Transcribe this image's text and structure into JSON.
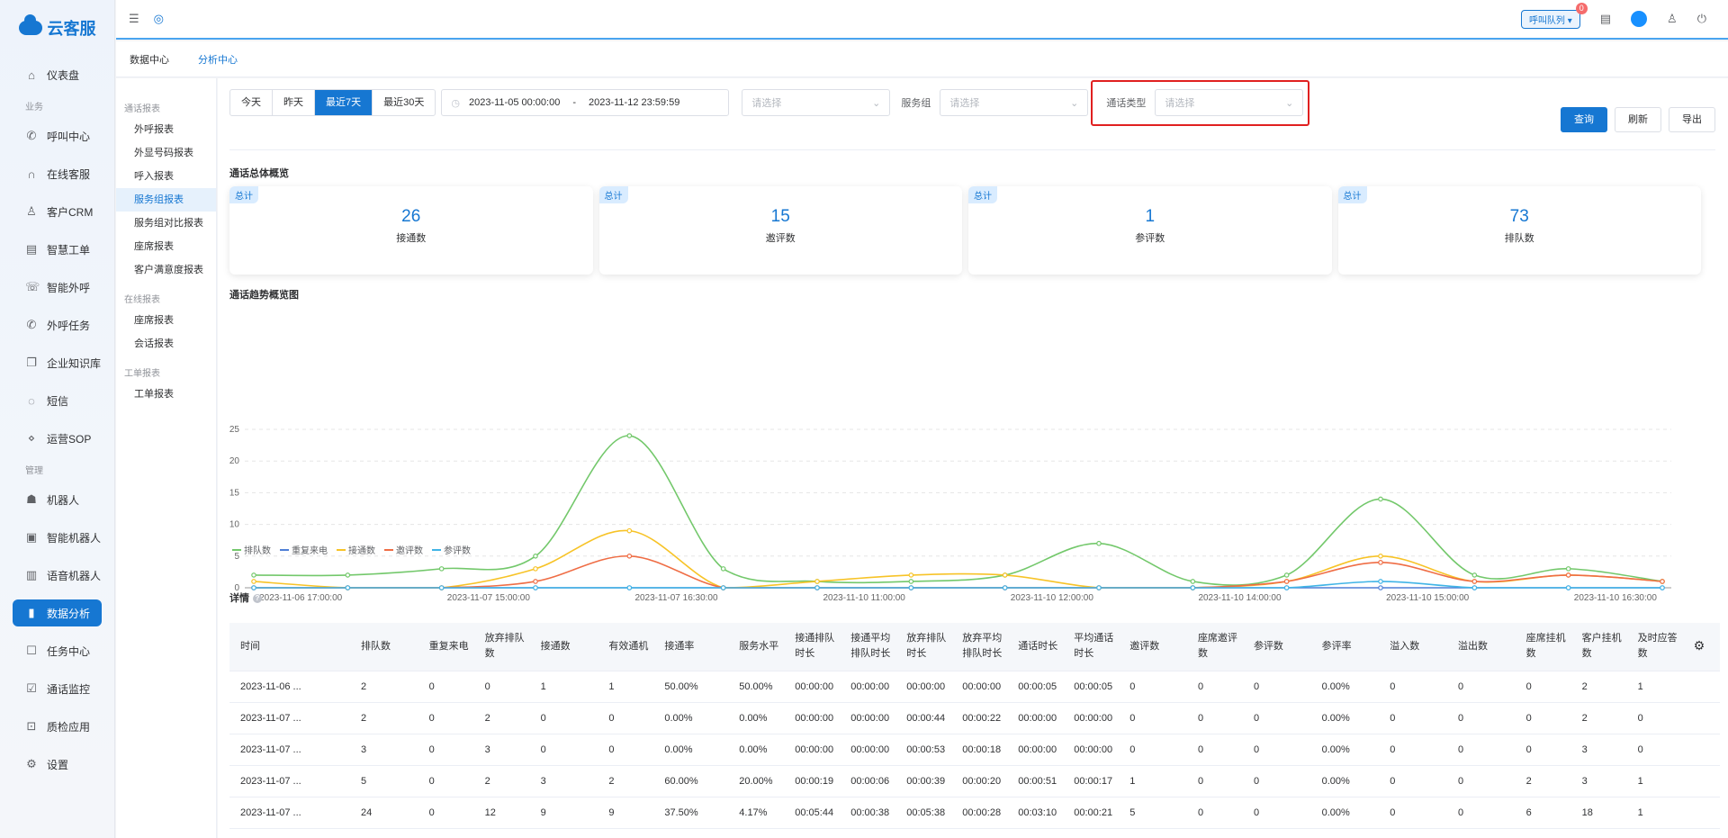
{
  "app": {
    "logo_text": "云客服"
  },
  "nav": {
    "items": [
      {
        "type": "item",
        "label": "仪表盘",
        "icon": "dashboard-icon",
        "glyph": "⌂"
      },
      {
        "type": "group",
        "label": "业务"
      },
      {
        "type": "item",
        "label": "呼叫中心",
        "icon": "phone-icon",
        "glyph": "✆"
      },
      {
        "type": "item",
        "label": "在线客服",
        "icon": "headset-icon",
        "glyph": "∩"
      },
      {
        "type": "item",
        "label": "客户CRM",
        "icon": "user-icon",
        "glyph": "♙"
      },
      {
        "type": "item",
        "label": "智慧工单",
        "icon": "document-icon",
        "glyph": "▤"
      },
      {
        "type": "item",
        "label": "智能外呼",
        "icon": "outbound-call-icon",
        "glyph": "☏"
      },
      {
        "type": "item",
        "label": "外呼任务",
        "icon": "task-call-icon",
        "glyph": "✆"
      },
      {
        "type": "item",
        "label": "企业知识库",
        "icon": "book-icon",
        "glyph": "❐"
      },
      {
        "type": "item",
        "label": "短信",
        "icon": "message-icon",
        "glyph": "◌"
      },
      {
        "type": "item",
        "label": "运营SOP",
        "icon": "flow-icon",
        "glyph": "⋄"
      },
      {
        "type": "group",
        "label": "管理"
      },
      {
        "type": "item",
        "label": "机器人",
        "icon": "robot-icon",
        "glyph": "☗"
      },
      {
        "type": "item",
        "label": "智能机器人",
        "icon": "smart-robot-icon",
        "glyph": "▣"
      },
      {
        "type": "item",
        "label": "语音机器人",
        "icon": "voice-robot-icon",
        "glyph": "▥"
      },
      {
        "type": "item",
        "label": "数据分析",
        "icon": "chart-icon",
        "glyph": "▮",
        "active": true
      },
      {
        "type": "item",
        "label": "任务中心",
        "icon": "task-icon",
        "glyph": "☐"
      },
      {
        "type": "item",
        "label": "通话监控",
        "icon": "monitor-icon",
        "glyph": "☑"
      },
      {
        "type": "item",
        "label": "质检应用",
        "icon": "inspect-icon",
        "glyph": "⊡"
      },
      {
        "type": "item",
        "label": "设置",
        "icon": "settings-icon",
        "glyph": "⚙"
      }
    ]
  },
  "topbar": {
    "queue_label": "呼叫队列",
    "queue_badge": "0"
  },
  "tabs": {
    "first": "数据中心",
    "second": "分析中心"
  },
  "submenu": [
    {
      "type": "group",
      "label": "通话报表"
    },
    {
      "type": "item",
      "label": "外呼报表"
    },
    {
      "type": "item",
      "label": "外显号码报表"
    },
    {
      "type": "item",
      "label": "呼入报表"
    },
    {
      "type": "item",
      "label": "服务组报表",
      "active": true
    },
    {
      "type": "item",
      "label": "服务组对比报表"
    },
    {
      "type": "item",
      "label": "座席报表"
    },
    {
      "type": "item",
      "label": "客户满意度报表"
    },
    {
      "type": "group",
      "label": "在线报表"
    },
    {
      "type": "item",
      "label": "座席报表"
    },
    {
      "type": "item",
      "label": "会话报表"
    },
    {
      "type": "group",
      "label": "工单报表"
    },
    {
      "type": "item",
      "label": "工单报表"
    }
  ],
  "filters": {
    "ranges": [
      "今天",
      "昨天",
      "最近7天",
      "最近30天"
    ],
    "active_range": "最近7天",
    "date_start": "2023-11-05 00:00:00",
    "date_sep": "-",
    "date_end": "2023-11-12 23:59:59",
    "select1_placeholder": "请选择",
    "group_label": "服务组",
    "group_placeholder": "请选择",
    "calltype_label": "通话类型",
    "calltype_placeholder": "请选择"
  },
  "actions": {
    "query": "查询",
    "refresh": "刷新",
    "export": "导出"
  },
  "overview": {
    "title": "通话总体概览",
    "cards": [
      {
        "tag": "总计",
        "value": "26",
        "caption": "接通数"
      },
      {
        "tag": "总计",
        "value": "15",
        "caption": "邀评数"
      },
      {
        "tag": "总计",
        "value": "1",
        "caption": "参评数"
      },
      {
        "tag": "总计",
        "value": "73",
        "caption": "排队数"
      }
    ]
  },
  "trend_title": "通话趋势概览图",
  "chart_data": {
    "type": "line",
    "ylim": [
      0,
      25
    ],
    "yticks": [
      0,
      5,
      10,
      15,
      20,
      25
    ],
    "x_tick_labels": [
      "2023-11-06 17:00:00",
      "2023-11-07 15:00:00",
      "2023-11-07 16:30:00",
      "2023-11-10 11:00:00",
      "2023-11-10 12:00:00",
      "2023-11-10 14:00:00",
      "2023-11-10 15:00:00",
      "2023-11-10 16:30:00"
    ],
    "point_count": 16,
    "grid": true,
    "legend_position": "bottom-left",
    "series": [
      {
        "name": "排队数",
        "color": "#73c86b",
        "values": [
          2,
          2,
          3,
          5,
          24,
          3,
          1,
          1,
          2,
          7,
          1,
          2,
          14,
          2,
          3,
          1
        ]
      },
      {
        "name": "重复来电",
        "color": "#4f7fd6",
        "values": [
          0,
          0,
          0,
          0,
          0,
          0,
          0,
          0,
          0,
          0,
          0,
          0,
          0,
          0,
          0,
          0
        ]
      },
      {
        "name": "接通数",
        "color": "#f7c327",
        "values": [
          1,
          0,
          0,
          3,
          9,
          0,
          1,
          2,
          2,
          0,
          0,
          1,
          5,
          1,
          2,
          1
        ]
      },
      {
        "name": "邀评数",
        "color": "#ef6d45",
        "values": [
          0,
          0,
          0,
          1,
          5,
          0,
          0,
          0,
          0,
          0,
          0,
          1,
          4,
          1,
          2,
          1
        ]
      },
      {
        "name": "参评数",
        "color": "#40b4e6",
        "values": [
          0,
          0,
          0,
          0,
          0,
          0,
          0,
          0,
          0,
          0,
          0,
          0,
          1,
          0,
          0,
          0
        ]
      }
    ]
  },
  "detail": {
    "title": "详情",
    "info": "?",
    "columns": [
      "时间",
      "排队数",
      "重复来电",
      "放弃排队数",
      "接通数",
      "有效通机",
      "接通率",
      "服务水平",
      "接通排队时长",
      "接通平均排队时长",
      "放弃排队时长",
      "放弃平均排队时长",
      "通话时长",
      "平均通话时长",
      "邀评数",
      "座席邀评数",
      "参评数",
      "参评率",
      "溢入数",
      "溢出数",
      "座席挂机数",
      "客户挂机数",
      "及时应答数"
    ],
    "rows": [
      [
        "2023-11-06 ...",
        "2",
        "0",
        "0",
        "1",
        "1",
        "50.00%",
        "50.00%",
        "00:00:00",
        "00:00:00",
        "00:00:00",
        "00:00:00",
        "00:00:05",
        "00:00:05",
        "0",
        "0",
        "0",
        "0.00%",
        "0",
        "0",
        "0",
        "2",
        "1"
      ],
      [
        "2023-11-07 ...",
        "2",
        "0",
        "2",
        "0",
        "0",
        "0.00%",
        "0.00%",
        "00:00:00",
        "00:00:00",
        "00:00:44",
        "00:00:22",
        "00:00:00",
        "00:00:00",
        "0",
        "0",
        "0",
        "0.00%",
        "0",
        "0",
        "0",
        "2",
        "0"
      ],
      [
        "2023-11-07 ...",
        "3",
        "0",
        "3",
        "0",
        "0",
        "0.00%",
        "0.00%",
        "00:00:00",
        "00:00:00",
        "00:00:53",
        "00:00:18",
        "00:00:00",
        "00:00:00",
        "0",
        "0",
        "0",
        "0.00%",
        "0",
        "0",
        "0",
        "3",
        "0"
      ],
      [
        "2023-11-07 ...",
        "5",
        "0",
        "2",
        "3",
        "2",
        "60.00%",
        "20.00%",
        "00:00:19",
        "00:00:06",
        "00:00:39",
        "00:00:20",
        "00:00:51",
        "00:00:17",
        "1",
        "0",
        "0",
        "0.00%",
        "0",
        "0",
        "2",
        "3",
        "1"
      ],
      [
        "2023-11-07 ...",
        "24",
        "0",
        "12",
        "9",
        "9",
        "37.50%",
        "4.17%",
        "00:05:44",
        "00:00:38",
        "00:05:38",
        "00:00:28",
        "00:03:10",
        "00:00:21",
        "5",
        "0",
        "0",
        "0.00%",
        "0",
        "0",
        "6",
        "18",
        "1"
      ]
    ]
  }
}
